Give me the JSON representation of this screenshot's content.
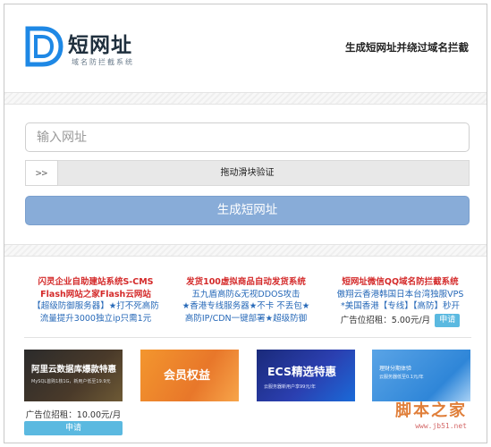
{
  "header": {
    "logo_title": "短网址",
    "logo_sub": "域名防拦截系统",
    "slogan": "生成短网址并绕过域名拦截"
  },
  "form": {
    "url_placeholder": "输入网址",
    "slider_handle": ">>",
    "slider_text": "拖动滑块验证",
    "generate_button": "生成短网址"
  },
  "ads": [
    {
      "title": "闪灵企业自助建站系统S-CMS",
      "lines": [
        "Flash网站之家Flash云网站",
        "【超级防御服务器】★打不死高防",
        "流量提升3000独立ip只需1元"
      ]
    },
    {
      "title": "发货100虚拟商品自动发货系统",
      "lines": [
        "五九盾高防&无视DDOS攻击",
        "★香港专线服务器★不卡 不丢包★",
        "高防IP/CDN一键部署★超级防御"
      ]
    },
    {
      "title": "短网址微信QQ域名防拦截系统",
      "lines": [
        "傲翔云香港韩国日本台湾独服VPS",
        "*美国香港【专线】【高防】秒开"
      ],
      "price": "广告位招租：5.00元/月",
      "apply": "申请"
    }
  ],
  "banners": [
    {
      "text_main": "阿里云数据库爆款特惠",
      "text_sub": "MySQL首购1核1G，新用户低至19.9元"
    },
    {
      "text_main": "会员权益",
      "text_sub": ""
    },
    {
      "text_main": "ECS精选特惠",
      "text_sub": "云服务器新用户享99元/年"
    },
    {
      "text_main": "理财分期体验",
      "text_sub": "云服务器低至0.1元/年"
    }
  ],
  "bottom": {
    "price": "广告位招租：10.00元/月",
    "apply": "申请"
  },
  "watermark": {
    "main": "脚本之家",
    "sub": "www.jb51.net"
  }
}
